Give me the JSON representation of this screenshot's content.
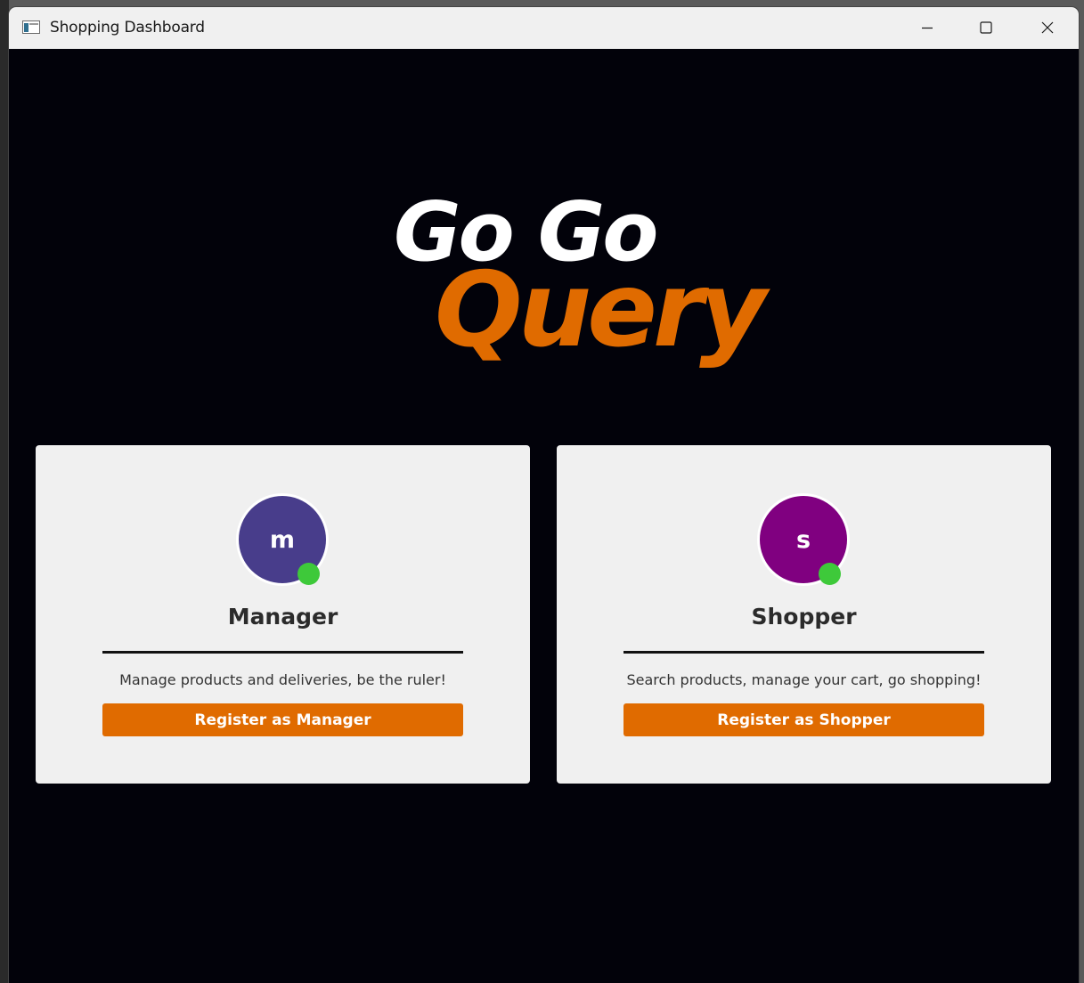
{
  "window": {
    "title": "Shopping Dashboard",
    "controls": [
      "minimize",
      "maximize",
      "close"
    ]
  },
  "logo": {
    "line1": "Go Go",
    "line2": "Query"
  },
  "cards": [
    {
      "initial": "m",
      "title": "Manager",
      "description": "Manage products and deliveries, be the ruler!",
      "button_label": "Register as Manager"
    },
    {
      "initial": "s",
      "title": "Shopper",
      "description": "Search products, manage your cart, go shopping!",
      "button_label": "Register as Shopper"
    }
  ],
  "colors": {
    "background": "#02020a",
    "accent": "#e06b00",
    "logo_primary": "#ffffff",
    "card_background": "#f0f0f0",
    "manager_avatar": "#483d8b",
    "shopper_avatar": "#800080",
    "online_status": "#3ec93a"
  },
  "icons": {
    "app": "window-app-icon",
    "minimize": "minimize-icon",
    "maximize": "maximize-icon",
    "close": "close-icon",
    "status": "online-status-icon"
  }
}
